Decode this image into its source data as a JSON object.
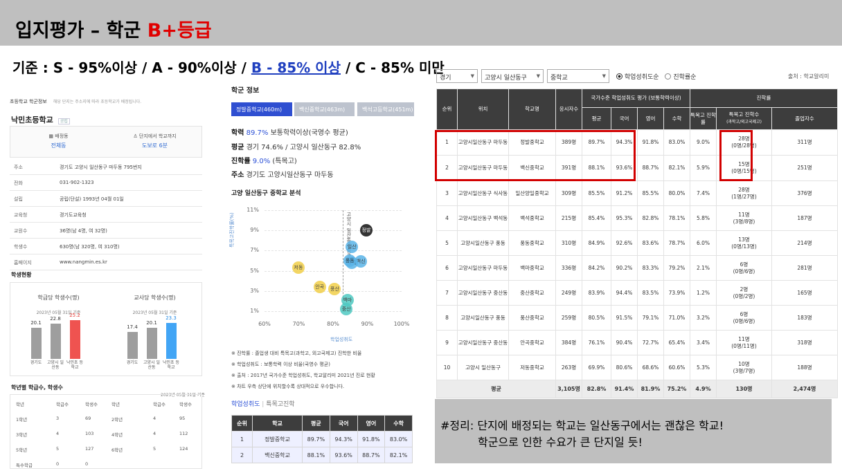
{
  "header": {
    "title_main": "입지평가 – 학군 ",
    "title_grade": "B+등급"
  },
  "criteria": {
    "part1": "기준 : S - 95%이상 / A - 90%이상 / ",
    "part2": "B - 85% 이상",
    "part3": " / C - 85% 미만"
  },
  "school_panel": {
    "header_label": "초등학교 학군정보",
    "header_note": "해당 단지는 주소지에 따라 초등학교가 배정됩니다.",
    "school_name": "낙민초등학교",
    "school_badge": "공립",
    "assign_label": "배정동",
    "assign_value": "전체동",
    "dist_label": "단지에서 학교까지",
    "dist_value": "도보로 6분",
    "rows": [
      {
        "k": "주소",
        "v": "경기도 고양시 일산동구 마두동 795번지"
      },
      {
        "k": "전화",
        "v": "031-902-1323"
      },
      {
        "k": "설립",
        "v": "공립(단설) 1993년 04월 01일"
      },
      {
        "k": "교육청",
        "v": "경기도교육청"
      },
      {
        "k": "교원수",
        "v": "36명(남 4명, 여 32명)"
      },
      {
        "k": "학생수",
        "v": "630명(남 320명, 여 310명)"
      },
      {
        "k": "홈페이지",
        "v": "www.nangmin.es.kr"
      }
    ],
    "status_title": "학생현황",
    "chart1": {
      "title": "학급당 학생수(명)",
      "date": "2023년 05월 31일 기준",
      "values": [
        20.1,
        22.8,
        25.2
      ],
      "labels": [
        "경기도",
        "고양시 일산동",
        "낙민초 등학교"
      ]
    },
    "chart2": {
      "title": "교사당 학생수(명)",
      "date": "2023년 05월 31일 기준",
      "values": [
        17.4,
        20.1,
        23.3
      ],
      "labels": [
        "경기도",
        "고양시 일산동",
        "낙민초 등학교"
      ]
    },
    "grade_title": "학년별 학급수, 학생수",
    "grade_date": "2023년 05월 31일 기준",
    "grade_headers": [
      "학년",
      "학급수",
      "학생수"
    ],
    "grade_left": [
      [
        "1학년",
        "3",
        "69"
      ],
      [
        "3학년",
        "4",
        "103"
      ],
      [
        "5학년",
        "5",
        "127"
      ],
      [
        "특수학급",
        "0",
        "0"
      ]
    ],
    "grade_right": [
      [
        "2학년",
        "4",
        "95"
      ],
      [
        "4학년",
        "4",
        "112"
      ],
      [
        "6학년",
        "5",
        "124"
      ]
    ]
  },
  "middle_panel": {
    "section_title": "학군 정보",
    "tabs": [
      "정발중학교(460m)",
      "백신중학교(463m)",
      "백석고등학교(451m)"
    ],
    "info1_label": "학력",
    "info1_hl": "89.7%",
    "info1_rest": "보통학력이상(국영수 평균)",
    "info2_label": "평균",
    "info2_rest": "경기 74.6% / 고양시 일산동구 82.8%",
    "info3_label": "진학률",
    "info3_hl": "9.0%",
    "info3_rest": "(특목고)",
    "info4_label": "주소",
    "info4_rest": "경기도 고양시일산동구 마두동",
    "chart_title": "고양 일산동구 중학교 분석",
    "chart_xlabel": "학업성취도",
    "chart_ylabel": "특목고진학률(%)",
    "chart_vlabel": "고양시 일산동구 평균",
    "x_ticks": [
      "60%",
      "70%",
      "80%",
      "90%",
      "100%"
    ],
    "y_ticks": [
      "11%",
      "9%",
      "7%",
      "5%",
      "3%",
      "1%"
    ],
    "bubbles": [
      {
        "name": "정발",
        "x": 89.7,
        "y": 9.0,
        "color": "#111111"
      },
      {
        "name": "백신",
        "x": 88.1,
        "y": 5.9,
        "color": "#5ab4e8"
      },
      {
        "name": "일산",
        "x": 85.5,
        "y": 7.4,
        "color": "#5ab4e8"
      },
      {
        "name": "백석",
        "x": 85.4,
        "y": 5.8,
        "color": "#5ab4e8"
      },
      {
        "name": "풍동",
        "x": 84.9,
        "y": 6.0,
        "color": "#5ab4e8"
      },
      {
        "name": "백마",
        "x": 84.2,
        "y": 2.1,
        "color": "#4fc9c2"
      },
      {
        "name": "중산",
        "x": 83.9,
        "y": 1.2,
        "color": "#4fc9c2"
      },
      {
        "name": "풍산",
        "x": 80.5,
        "y": 3.2,
        "color": "#f2cf4a"
      },
      {
        "name": "안곡",
        "x": 76.1,
        "y": 3.4,
        "color": "#f2cf4a"
      },
      {
        "name": "저동",
        "x": 69.9,
        "y": 5.3,
        "color": "#f2cf4a"
      }
    ],
    "notes": [
      "※ 진학률 : 졸업생 대비 특목고(과학고, 외고국제고) 진학한 비율",
      "※ 학업성취도 : 보통학력 이상 비율(국영수 평균)",
      "※ 출처 : 2017년 국가수준 학업성취도, 학교알리미 2021년 진로 현황",
      "※ 차트 우측 상단에 위치할수록 상대적으로 우수합니다."
    ],
    "subtab_active": "학업성취도",
    "subtab_other": "특목고진학",
    "table_headers": [
      "순위",
      "학교",
      "평균",
      "국어",
      "영어",
      "수학"
    ],
    "table_rows": [
      [
        "1",
        "정발중학교",
        "89.7%",
        "94.3%",
        "91.8%",
        "83.0%"
      ],
      [
        "2",
        "백신중학교",
        "88.1%",
        "93.6%",
        "88.7%",
        "82.1%"
      ]
    ]
  },
  "right_panel": {
    "filters": [
      "경기",
      "고양시 일산동구",
      "중학교"
    ],
    "radio1": "학업성취도순",
    "radio2": "진학률순",
    "source": "출처 : 학교알리미",
    "h_rank": "순위",
    "h_loc": "위치",
    "h_school": "학교명",
    "h_count": "응시자수",
    "h_group1": "국가수준 학업성취도 평가 (보통학력이상)",
    "h_group2": "진학률",
    "h_avg": "평균",
    "h_kor": "국어",
    "h_eng": "영어",
    "h_math": "수학",
    "h_rate": "특목고 진학률",
    "h_adv": "특목고 진학수",
    "h_adv_sub": "(과학고/외고국제고)",
    "h_grad": "졸업자수",
    "rows": [
      {
        "rank": "1",
        "loc": "고양시일산동구 마두동",
        "school": "정발중학교",
        "count": "389명",
        "avg": "89.7%",
        "kor": "94.3%",
        "eng": "91.8%",
        "math": "83.0%",
        "rate": "9.0%",
        "adv": "28명",
        "adv_sub": "(0명/28명)",
        "grad": "311명"
      },
      {
        "rank": "2",
        "loc": "고양시일산동구 마두동",
        "school": "백신중학교",
        "count": "391명",
        "avg": "88.1%",
        "kor": "93.6%",
        "eng": "88.7%",
        "math": "82.1%",
        "rate": "5.9%",
        "adv": "15명",
        "adv_sub": "(0명/15명)",
        "grad": "251명"
      },
      {
        "rank": "3",
        "loc": "고양시일산동구 식사동",
        "school": "일산양일중학교",
        "count": "309명",
        "avg": "85.5%",
        "kor": "91.2%",
        "eng": "85.5%",
        "math": "80.0%",
        "rate": "7.4%",
        "adv": "28명",
        "adv_sub": "(1명/27명)",
        "grad": "376명"
      },
      {
        "rank": "4",
        "loc": "고양시일산동구 백석동",
        "school": "백석중학교",
        "count": "215명",
        "avg": "85.4%",
        "kor": "95.3%",
        "eng": "82.8%",
        "math": "78.1%",
        "rate": "5.8%",
        "adv": "11명",
        "adv_sub": "(3명/8명)",
        "grad": "187명"
      },
      {
        "rank": "5",
        "loc": "고양시일산동구 풍동",
        "school": "풍동중학교",
        "count": "310명",
        "avg": "84.9%",
        "kor": "92.6%",
        "eng": "83.6%",
        "math": "78.7%",
        "rate": "6.0%",
        "adv": "13명",
        "adv_sub": "(0명/13명)",
        "grad": "214명"
      },
      {
        "rank": "6",
        "loc": "고양시일산동구 마두동",
        "school": "백마중학교",
        "count": "336명",
        "avg": "84.2%",
        "kor": "90.2%",
        "eng": "83.3%",
        "math": "79.2%",
        "rate": "2.1%",
        "adv": "6명",
        "adv_sub": "(0명/6명)",
        "grad": "281명"
      },
      {
        "rank": "7",
        "loc": "고양시일산동구 중산동",
        "school": "중산중학교",
        "count": "249명",
        "avg": "83.9%",
        "kor": "94.4%",
        "eng": "83.5%",
        "math": "73.9%",
        "rate": "1.2%",
        "adv": "2명",
        "adv_sub": "(0명/2명)",
        "grad": "165명"
      },
      {
        "rank": "8",
        "loc": "고양시일산동구 풍동",
        "school": "풍산중학교",
        "count": "259명",
        "avg": "80.5%",
        "kor": "91.5%",
        "eng": "79.1%",
        "math": "71.0%",
        "rate": "3.2%",
        "adv": "6명",
        "adv_sub": "(0명/6명)",
        "grad": "183명"
      },
      {
        "rank": "9",
        "loc": "고양시일산동구 중산동",
        "school": "안곡중학교",
        "count": "384명",
        "avg": "76.1%",
        "kor": "90.4%",
        "eng": "72.7%",
        "math": "65.4%",
        "rate": "3.4%",
        "adv": "11명",
        "adv_sub": "(0명/11명)",
        "grad": "318명"
      },
      {
        "rank": "10",
        "loc": "고양시 일산동구",
        "school": "저동중학교",
        "count": "263명",
        "avg": "69.9%",
        "kor": "80.6%",
        "eng": "68.6%",
        "math": "60.6%",
        "rate": "5.3%",
        "adv": "10명",
        "adv_sub": "(3명/7명)",
        "grad": "188명"
      }
    ],
    "avg_row": {
      "label": "평균",
      "count": "3,105명",
      "avg": "82.8%",
      "kor": "91.4%",
      "eng": "81.9%",
      "math": "75.2%",
      "rate": "4.9%",
      "adv": "130명",
      "grad": "2,474명"
    }
  },
  "summary": {
    "line1": "#정리: 단지에 배정되는 학교는 일산동구에서는 괜찮은 학교!",
    "line2": "학군으로 인한 수요가 큰 단지일 듯!"
  }
}
